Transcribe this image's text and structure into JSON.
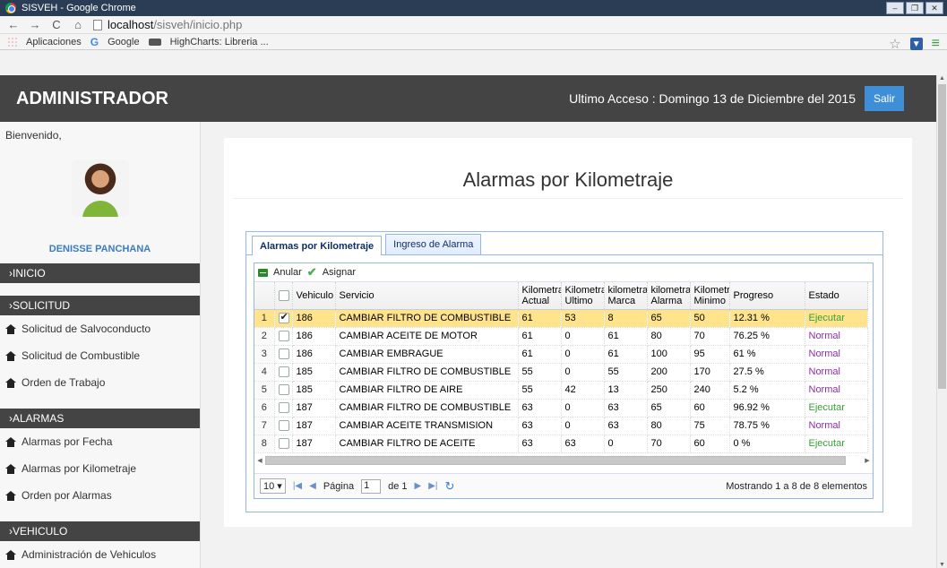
{
  "window": {
    "title": "SISVEH - Google Chrome"
  },
  "browser": {
    "url_host": "localhost",
    "url_path": "/sisveh/inicio.php",
    "bookmarks": [
      "Aplicaciones",
      "Google",
      "HighCharts: Libreria ..."
    ]
  },
  "header": {
    "brand": "ADMINISTRADOR",
    "last_access": "Ultimo Acceso : Domingo 13 de Diciembre del 2015",
    "logout_label": "Salir"
  },
  "sidebar": {
    "welcome": "Bienvenido,",
    "user_name": "DENISSE PANCHANA",
    "sections": {
      "inicio": "›INICIO",
      "solicitud": "›SOLICITUD",
      "alarmas": "›ALARMAS",
      "vehiculo": "›VEHICULO"
    },
    "solicitud_items": [
      "Solicitud de Salvoconducto",
      "Solicitud de Combustible",
      "Orden de Trabajo"
    ],
    "alarmas_items": [
      "Alarmas por Fecha",
      "Alarmas por Kilometraje",
      "Orden por Alarmas"
    ],
    "vehiculo_items": [
      "Administración de Vehiculos"
    ]
  },
  "main": {
    "title": "Alarmas por Kilometraje",
    "tabs": [
      "Alarmas por Kilometraje",
      "Ingreso de Alarma"
    ],
    "toolbar": {
      "anular": "Anular",
      "asignar": "Asignar"
    },
    "columns": {
      "vehiculo": "Vehiculo",
      "servicio": "Servicio",
      "km_actual_1": "Kilometraj",
      "km_actual_2": "Actual",
      "km_ultimo_1": "Kilometraj",
      "km_ultimo_2": "Ultimo",
      "km_marca_1": "kilometraje",
      "km_marca_2": "Marca",
      "km_alarma_1": "kilometraje",
      "km_alarma_2": "Alarma",
      "km_minimo_1": "Kilometraj",
      "km_minimo_2": "Minimo",
      "progreso": "Progreso",
      "estado": "Estado"
    },
    "rows": [
      {
        "n": "1",
        "veh": "186",
        "serv": "CAMBIAR FILTRO DE COMBUSTIBLE",
        "actual": "61",
        "ultimo": "53",
        "marca": "8",
        "alarma": "65",
        "minimo": "50",
        "progreso": "12.31 %",
        "estado": "Ejecutar"
      },
      {
        "n": "2",
        "veh": "186",
        "serv": "CAMBIAR ACEITE DE MOTOR",
        "actual": "61",
        "ultimo": "0",
        "marca": "61",
        "alarma": "80",
        "minimo": "70",
        "progreso": "76.25 %",
        "estado": "Normal"
      },
      {
        "n": "3",
        "veh": "186",
        "serv": "CAMBIAR EMBRAGUE",
        "actual": "61",
        "ultimo": "0",
        "marca": "61",
        "alarma": "100",
        "minimo": "95",
        "progreso": "61 %",
        "estado": "Normal"
      },
      {
        "n": "4",
        "veh": "185",
        "serv": "CAMBIAR FILTRO DE COMBUSTIBLE",
        "actual": "55",
        "ultimo": "0",
        "marca": "55",
        "alarma": "200",
        "minimo": "170",
        "progreso": "27.5 %",
        "estado": "Normal"
      },
      {
        "n": "5",
        "veh": "185",
        "serv": "CAMBIAR FILTRO DE AIRE",
        "actual": "55",
        "ultimo": "42",
        "marca": "13",
        "alarma": "250",
        "minimo": "240",
        "progreso": "5.2 %",
        "estado": "Normal"
      },
      {
        "n": "6",
        "veh": "187",
        "serv": "CAMBIAR FILTRO DE COMBUSTIBLE",
        "actual": "63",
        "ultimo": "0",
        "marca": "63",
        "alarma": "65",
        "minimo": "60",
        "progreso": "96.92 %",
        "estado": "Ejecutar"
      },
      {
        "n": "7",
        "veh": "187",
        "serv": "CAMBIAR ACEITE TRANSMISION",
        "actual": "63",
        "ultimo": "0",
        "marca": "63",
        "alarma": "80",
        "minimo": "75",
        "progreso": "78.75 %",
        "estado": "Normal"
      },
      {
        "n": "8",
        "veh": "187",
        "serv": "CAMBIAR FILTRO DE ACEITE",
        "actual": "63",
        "ultimo": "63",
        "marca": "0",
        "alarma": "70",
        "minimo": "60",
        "progreso": "0 %",
        "estado": "Ejecutar"
      }
    ],
    "pager": {
      "page_size": "10",
      "page_label": "Página",
      "page_value": "1",
      "of_label": "de 1",
      "info": "Mostrando 1 a 8 de 8 elementos"
    }
  },
  "colors": {
    "header_bg": "#444444",
    "accent": "#3f8fd8",
    "selected_row": "#ffe48d",
    "estado_ejecutar": "#3a9d3a",
    "estado_normal": "#8b2fa8"
  }
}
